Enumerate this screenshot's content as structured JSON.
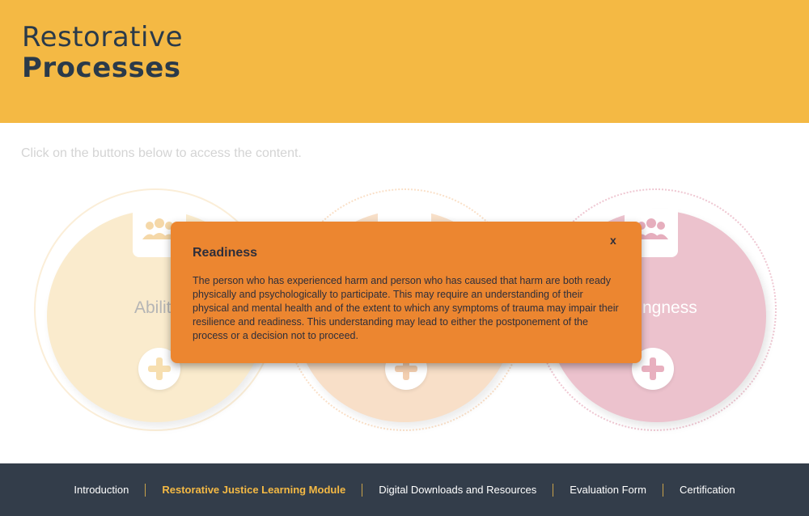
{
  "header": {
    "title_line1": "Restorative",
    "title_line2": "Processes",
    "background": "#f4b944"
  },
  "instruction": "Click on the buttons below to access the content.",
  "cards": [
    {
      "label": "Abilit",
      "icon": "people-icon",
      "color": "#faebcd",
      "plus_color": "#f7dfb0"
    },
    {
      "label": "",
      "icon": "people-icon",
      "color": "#f8dfc8",
      "plus_color": "#f3cfb0"
    },
    {
      "label": "ngness",
      "icon": "people-icon",
      "color": "#ecc2cd",
      "plus_color": "#e8b0bf"
    }
  ],
  "modal": {
    "title": "Readiness",
    "close_label": "x",
    "body": "The person who has experienced harm and person who has caused that harm are both ready physically and psychologically to participate. This may require an understanding of their physical and mental health and of the extent to which any symptoms of trauma may impair their resilience and readiness. This understanding may lead to either the postponement of the process or a decision not to proceed.",
    "background": "#ec8630"
  },
  "footer": {
    "nav": [
      {
        "label": "Introduction",
        "active": false
      },
      {
        "label": "Restorative Justice Learning Module",
        "active": true
      },
      {
        "label": "Digital Downloads and Resources",
        "active": false
      },
      {
        "label": "Evaluation Form",
        "active": false
      },
      {
        "label": "Certification",
        "active": false
      }
    ],
    "background": "#333d4a",
    "active_color": "#f4b944"
  }
}
